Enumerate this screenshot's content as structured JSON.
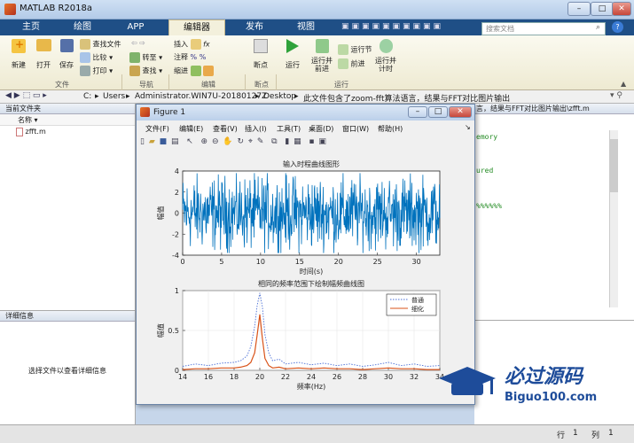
{
  "app": {
    "title": "MATLAB R2018a"
  },
  "window_controls": {
    "min": "–",
    "max": "□",
    "close": "✕"
  },
  "tabs": [
    {
      "label": "主页"
    },
    {
      "label": "绘图"
    },
    {
      "label": "APP"
    },
    {
      "label": "编辑器"
    },
    {
      "label": "发布"
    },
    {
      "label": "视图"
    }
  ],
  "search": {
    "placeholder": "搜索文档"
  },
  "toolstrip": {
    "new": "新建",
    "open": "打开",
    "save": "保存",
    "find_files": "查找文件",
    "compare": "比较",
    "print": "打印",
    "goto": "转至",
    "find": "查找",
    "insert": "插入",
    "comment": "注释",
    "indent": "缩进",
    "breakpoints": "断点",
    "run": "运行",
    "run_advance": "运行并\n前进",
    "run_section": "运行节",
    "advance": "前进",
    "run_time": "运行并\n计时",
    "groups": {
      "file": "文件",
      "navigate": "导航",
      "edit": "编辑",
      "breakpoints": "断点",
      "run": "运行"
    }
  },
  "address": {
    "segments": [
      "C:",
      "Users",
      "Administrator.WIN7U-20180127Z",
      "Desktop",
      "此文件包含了zoom-fft算法语言，结果与FFT对比图片输出"
    ],
    "right_text": "言，结果与FFT对比图片输出\\zfft.m"
  },
  "left_panel": {
    "header": "当前文件夹",
    "col_name": "名称",
    "files": [
      {
        "name": "zfft.m"
      }
    ],
    "details_header": "详细信息",
    "details_hint": "选择文件以查看详细信息"
  },
  "editor_snippets": [
    "emory",
    "ured",
    "%%%%%%"
  ],
  "status": {
    "row_label": "行",
    "row": "1",
    "col_label": "列",
    "col": "1"
  },
  "figure": {
    "title": "Figure 1",
    "menu": [
      "文件(F)",
      "编辑(E)",
      "查看(V)",
      "插入(I)",
      "工具(T)",
      "桌面(D)",
      "窗口(W)",
      "帮助(H)"
    ]
  },
  "chart_data": [
    {
      "type": "line",
      "title": "输入时程曲线图形",
      "xlabel": "时间(s)",
      "ylabel": "幅值",
      "xlim": [
        0,
        33
      ],
      "ylim": [
        -4,
        4
      ],
      "xticks": [
        0,
        5,
        10,
        15,
        20,
        25,
        30
      ],
      "yticks": [
        -4,
        -2,
        0,
        2,
        4
      ],
      "series": [
        {
          "color": "#0072bd",
          "noise_amplitude": 4,
          "samples": 700
        }
      ]
    },
    {
      "type": "line",
      "title": "相同的频率范围下绘制幅频曲线图",
      "xlabel": "频率(Hz)",
      "ylabel": "幅值",
      "xlim": [
        14,
        34
      ],
      "ylim": [
        0,
        1
      ],
      "xticks": [
        14,
        16,
        18,
        20,
        22,
        24,
        26,
        28,
        30,
        32,
        34
      ],
      "yticks": [
        0,
        0.5,
        1
      ],
      "grid": true,
      "legend": "top-right",
      "series": [
        {
          "name": "普通",
          "color": "#4a6fd6",
          "style": "dotted",
          "x": [
            14,
            15,
            16,
            17,
            18,
            18.5,
            19,
            19.3,
            19.6,
            19.8,
            20,
            20.2,
            20.4,
            20.7,
            21,
            21.5,
            22,
            23,
            24,
            25,
            26,
            27,
            28,
            29,
            30,
            31,
            32,
            33,
            34
          ],
          "y": [
            0.05,
            0.08,
            0.06,
            0.09,
            0.1,
            0.12,
            0.18,
            0.3,
            0.55,
            0.82,
            0.97,
            0.8,
            0.45,
            0.22,
            0.12,
            0.14,
            0.08,
            0.1,
            0.07,
            0.09,
            0.06,
            0.08,
            0.05,
            0.07,
            0.1,
            0.06,
            0.08,
            0.05,
            0.06
          ]
        },
        {
          "name": "细化",
          "color": "#d95319",
          "style": "solid",
          "x": [
            14,
            15,
            16,
            17,
            18,
            18.5,
            19,
            19.3,
            19.6,
            19.8,
            20,
            20.2,
            20.4,
            20.7,
            21,
            21.5,
            22,
            23,
            24,
            25,
            26,
            27,
            28,
            29,
            30,
            31,
            32,
            33,
            34
          ],
          "y": [
            0.01,
            0.02,
            0.02,
            0.03,
            0.03,
            0.04,
            0.06,
            0.1,
            0.22,
            0.45,
            0.7,
            0.4,
            0.15,
            0.06,
            0.03,
            0.04,
            0.02,
            0.03,
            0.02,
            0.03,
            0.02,
            0.02,
            0.01,
            0.02,
            0.03,
            0.02,
            0.02,
            0.01,
            0.01
          ]
        }
      ]
    }
  ],
  "watermark": {
    "text": "必过源码",
    "sub": "Biguo100.com"
  }
}
